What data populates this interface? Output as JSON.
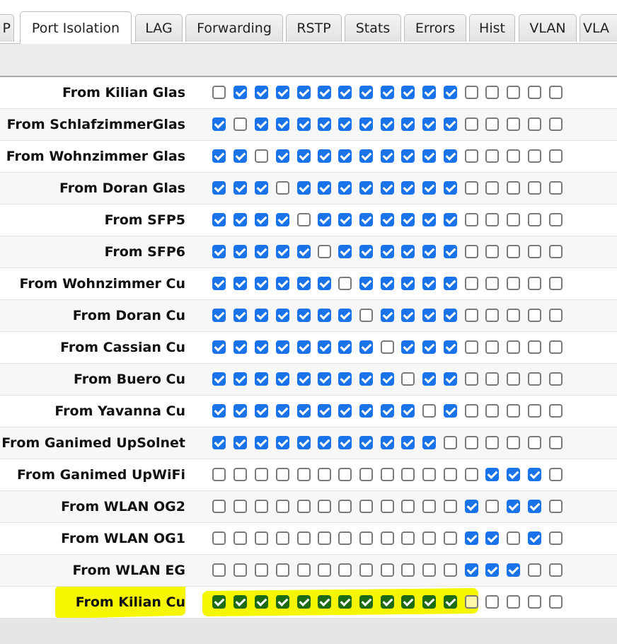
{
  "tabs": [
    {
      "label": "P",
      "active": false
    },
    {
      "label": "Port Isolation",
      "active": true
    },
    {
      "label": "LAG",
      "active": false
    },
    {
      "label": "Forwarding",
      "active": false
    },
    {
      "label": "RSTP",
      "active": false
    },
    {
      "label": "Stats",
      "active": false
    },
    {
      "label": "Errors",
      "active": false
    },
    {
      "label": "Hist",
      "active": false
    },
    {
      "label": "VLAN",
      "active": false
    },
    {
      "label": "VLA",
      "active": false
    }
  ],
  "rows": [
    {
      "label": "From Kilian Glas",
      "checks": [
        0,
        1,
        1,
        1,
        1,
        1,
        1,
        1,
        1,
        1,
        1,
        1,
        0,
        0,
        0,
        0,
        0
      ]
    },
    {
      "label": "From SchlafzimmerGlas",
      "checks": [
        1,
        0,
        1,
        1,
        1,
        1,
        1,
        1,
        1,
        1,
        1,
        1,
        0,
        0,
        0,
        0,
        0
      ]
    },
    {
      "label": "From Wohnzimmer Glas",
      "checks": [
        1,
        1,
        0,
        1,
        1,
        1,
        1,
        1,
        1,
        1,
        1,
        1,
        0,
        0,
        0,
        0,
        0
      ]
    },
    {
      "label": "From Doran Glas",
      "checks": [
        1,
        1,
        1,
        0,
        1,
        1,
        1,
        1,
        1,
        1,
        1,
        1,
        0,
        0,
        0,
        0,
        0
      ]
    },
    {
      "label": "From SFP5",
      "checks": [
        1,
        1,
        1,
        1,
        0,
        1,
        1,
        1,
        1,
        1,
        1,
        1,
        0,
        0,
        0,
        0,
        0
      ]
    },
    {
      "label": "From SFP6",
      "checks": [
        1,
        1,
        1,
        1,
        1,
        0,
        1,
        1,
        1,
        1,
        1,
        1,
        0,
        0,
        0,
        0,
        0
      ]
    },
    {
      "label": "From Wohnzimmer Cu",
      "checks": [
        1,
        1,
        1,
        1,
        1,
        1,
        0,
        1,
        1,
        1,
        1,
        1,
        0,
        0,
        0,
        0,
        0
      ]
    },
    {
      "label": "From Doran Cu",
      "checks": [
        1,
        1,
        1,
        1,
        1,
        1,
        1,
        0,
        1,
        1,
        1,
        1,
        0,
        0,
        0,
        0,
        0
      ]
    },
    {
      "label": "From Cassian Cu",
      "checks": [
        1,
        1,
        1,
        1,
        1,
        1,
        1,
        1,
        0,
        1,
        1,
        1,
        0,
        0,
        0,
        0,
        0
      ]
    },
    {
      "label": "From Buero Cu",
      "checks": [
        1,
        1,
        1,
        1,
        1,
        1,
        1,
        1,
        1,
        0,
        1,
        1,
        0,
        0,
        0,
        0,
        0
      ]
    },
    {
      "label": "From Yavanna Cu",
      "checks": [
        1,
        1,
        1,
        1,
        1,
        1,
        1,
        1,
        1,
        1,
        0,
        1,
        0,
        0,
        0,
        0,
        0
      ]
    },
    {
      "label": "From Ganimed UpSolnet",
      "checks": [
        1,
        1,
        1,
        1,
        1,
        1,
        1,
        1,
        1,
        1,
        1,
        0,
        0,
        0,
        0,
        0,
        0
      ]
    },
    {
      "label": "From Ganimed UpWiFi",
      "checks": [
        0,
        0,
        0,
        0,
        0,
        0,
        0,
        0,
        0,
        0,
        0,
        0,
        0,
        1,
        1,
        1,
        0
      ]
    },
    {
      "label": "From WLAN OG2",
      "checks": [
        0,
        0,
        0,
        0,
        0,
        0,
        0,
        0,
        0,
        0,
        0,
        0,
        1,
        0,
        1,
        1,
        0
      ]
    },
    {
      "label": "From WLAN OG1",
      "checks": [
        0,
        0,
        0,
        0,
        0,
        0,
        0,
        0,
        0,
        0,
        0,
        0,
        1,
        1,
        0,
        1,
        0
      ]
    },
    {
      "label": "From WLAN EG",
      "checks": [
        0,
        0,
        0,
        0,
        0,
        0,
        0,
        0,
        0,
        0,
        0,
        0,
        1,
        1,
        1,
        0,
        0
      ]
    },
    {
      "label": "From Kilian Cu",
      "checks": [
        1,
        1,
        1,
        1,
        1,
        1,
        1,
        1,
        1,
        1,
        1,
        1,
        0,
        0,
        0,
        0,
        0
      ],
      "highlighted": true
    }
  ],
  "colors": {
    "checked": "#1a73e8",
    "highlight_marker": "#f6f600",
    "highlight_checked": "#1d6b12"
  }
}
